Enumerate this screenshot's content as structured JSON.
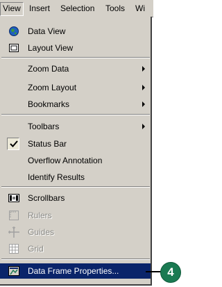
{
  "menubar": {
    "items": [
      {
        "label": "View"
      },
      {
        "label": "Insert"
      },
      {
        "label": "Selection"
      },
      {
        "label": "Tools"
      },
      {
        "label": "Wi"
      }
    ]
  },
  "menu": {
    "items": [
      {
        "label": "Data View",
        "icon": "globe-icon"
      },
      {
        "label": "Layout View",
        "icon": "page-icon"
      },
      {
        "label": "Zoom Data"
      },
      {
        "label": "Zoom Layout"
      },
      {
        "label": "Bookmarks"
      },
      {
        "label": "Toolbars"
      },
      {
        "label": "Status Bar"
      },
      {
        "label": "Overflow Annotation"
      },
      {
        "label": "Identify Results"
      },
      {
        "label": "Scrollbars",
        "icon": "scrollbars-icon"
      },
      {
        "label": "Rulers",
        "icon": "rulers-icon"
      },
      {
        "label": "Guides",
        "icon": "guides-icon"
      },
      {
        "label": "Grid",
        "icon": "grid-icon"
      },
      {
        "label": "Data Frame Properties...",
        "icon": "data-frame-properties-icon"
      }
    ]
  },
  "callout": {
    "number": "4"
  },
  "colors": {
    "menu_bg": "#d4d0c8",
    "highlight": "#0a246a",
    "callout": "#1a7a52"
  }
}
